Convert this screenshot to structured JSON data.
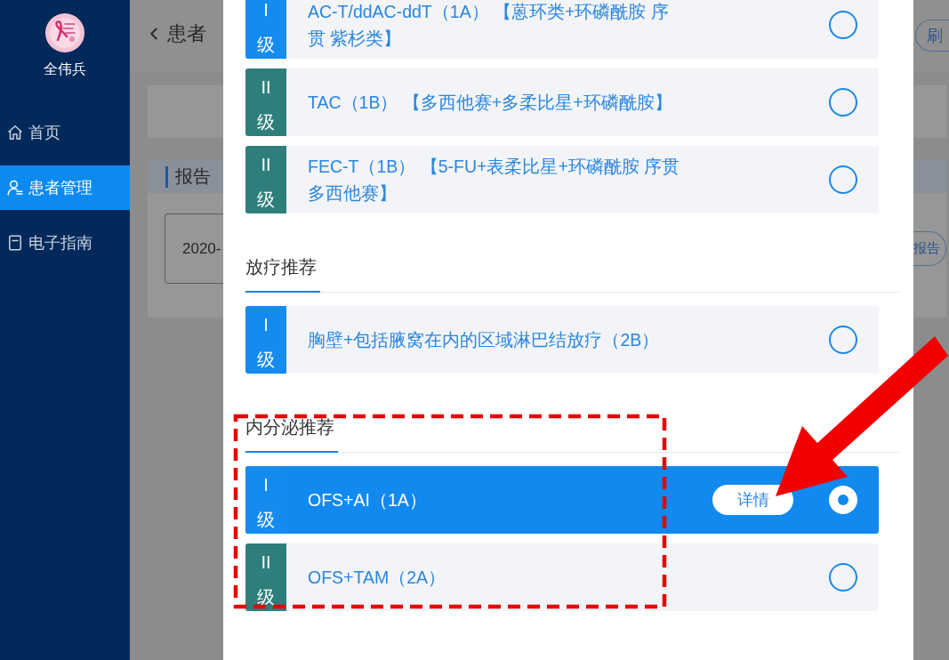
{
  "sidebar": {
    "user_name": "全伟兵",
    "items": [
      {
        "kind": "home",
        "label": "首页",
        "selected": false
      },
      {
        "kind": "user",
        "label": "患者管理",
        "selected": true
      },
      {
        "kind": "document",
        "label": "电子指南",
        "selected": false
      }
    ]
  },
  "page": {
    "title": "患者",
    "refresh_button": "刷",
    "section_title": "报告",
    "date_field": "2020-",
    "report_button": "报告"
  },
  "dialog": {
    "sections": [
      {
        "items": [
          {
            "level": "I",
            "level_unit": "级",
            "color": "#168bef",
            "text": "AC-T/ddAC-ddT（1A） 【蒽环类+环磷酰胺 序贯 紫杉类】",
            "selected": false
          },
          {
            "level": "II",
            "level_unit": "级",
            "color": "#2e7f7b",
            "text": "TAC（1B） 【多西他赛+多柔比星+环磷酰胺】",
            "selected": false
          },
          {
            "level": "II",
            "level_unit": "级",
            "color": "#2e7f7b",
            "text": "FEC-T（1B） 【5-FU+表柔比星+环磷酰胺 序贯多西他赛】",
            "selected": false
          }
        ]
      },
      {
        "title": "放疗推荐",
        "items": [
          {
            "level": "I",
            "level_unit": "级",
            "color": "#168bef",
            "text": "胸壁+包括腋窝在内的区域淋巴结放疗（2B）",
            "selected": false
          }
        ]
      },
      {
        "title": "内分泌推荐",
        "items": [
          {
            "level": "I",
            "level_unit": "级",
            "color": "#168bef",
            "text": "OFS+AI（1A）",
            "selected": true,
            "action": "详情"
          },
          {
            "level": "II",
            "level_unit": "级",
            "color": "#2e7f7b",
            "text": "OFS+TAM（2A）",
            "selected": false
          }
        ]
      }
    ]
  }
}
